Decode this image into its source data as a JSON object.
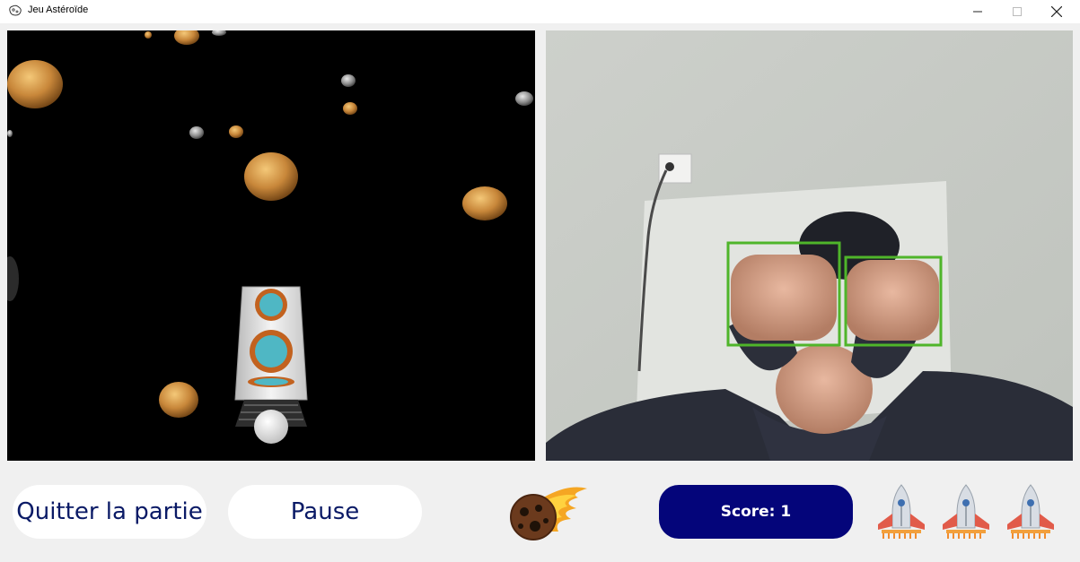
{
  "window": {
    "title": "Jeu Astéroïde",
    "controls": [
      "minimize-icon",
      "maximize-icon",
      "close-icon"
    ]
  },
  "controls": {
    "quit_label": "Quitter la partie",
    "pause_label": "Pause"
  },
  "score": {
    "label": "Score: 1"
  },
  "lives": {
    "count": 3,
    "icon": "rocket-icon"
  },
  "hud_icon": "meteor-icon",
  "camera": {
    "detected_hands": 2,
    "box_color": "#4fb52a"
  },
  "colors": {
    "score_bg": "#04057a",
    "button_text": "#0a1a66",
    "game_bg": "#000000"
  }
}
